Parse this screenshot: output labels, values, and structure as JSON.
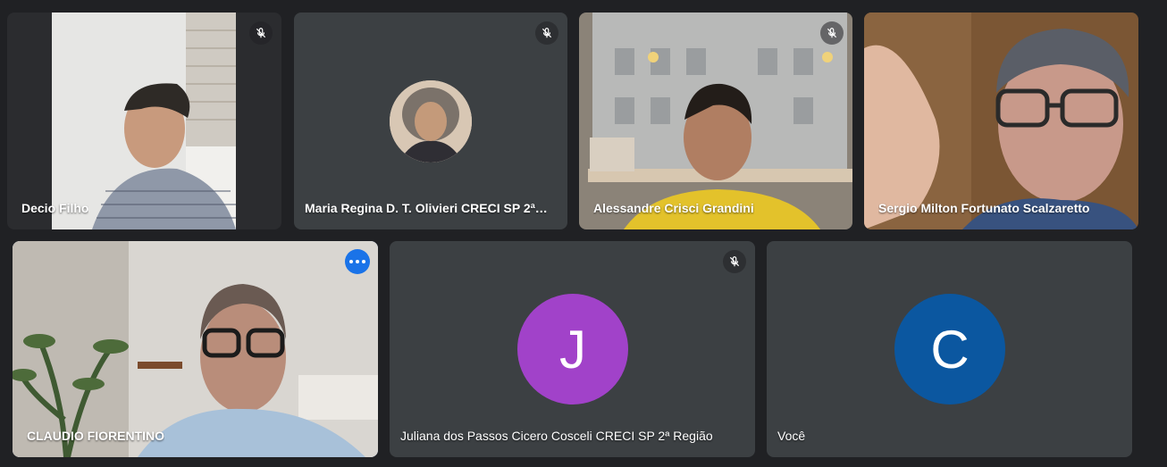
{
  "participants_top": [
    {
      "name": "Decio Filho",
      "muted": true
    },
    {
      "name": "Maria Regina D. T. Olivieri CRECI SP 2ª R...",
      "muted": true
    },
    {
      "name": "Alessandre Crisci Grandini",
      "muted": true
    },
    {
      "name": "Sergio Milton Fortunato Scalzaretto",
      "muted": false
    }
  ],
  "participants_bottom": [
    {
      "name": "CLAUDIO FIORENTINO",
      "muted": false
    },
    {
      "name": "Juliana dos Passos Cicero Cosceli CRECI SP 2ª Região",
      "muted": true,
      "initial": "J",
      "avatar_color": "#a142c9"
    },
    {
      "name": "Você",
      "muted": false,
      "initial": "C",
      "avatar_color": "#0b57a0"
    }
  ],
  "icons": {
    "mic_off": "mic-off-icon",
    "more": "more-options-icon"
  },
  "colors": {
    "background": "#202124",
    "tile": "#3c4043",
    "active_outline": "#8ab4f8",
    "accent": "#1a73e8"
  }
}
